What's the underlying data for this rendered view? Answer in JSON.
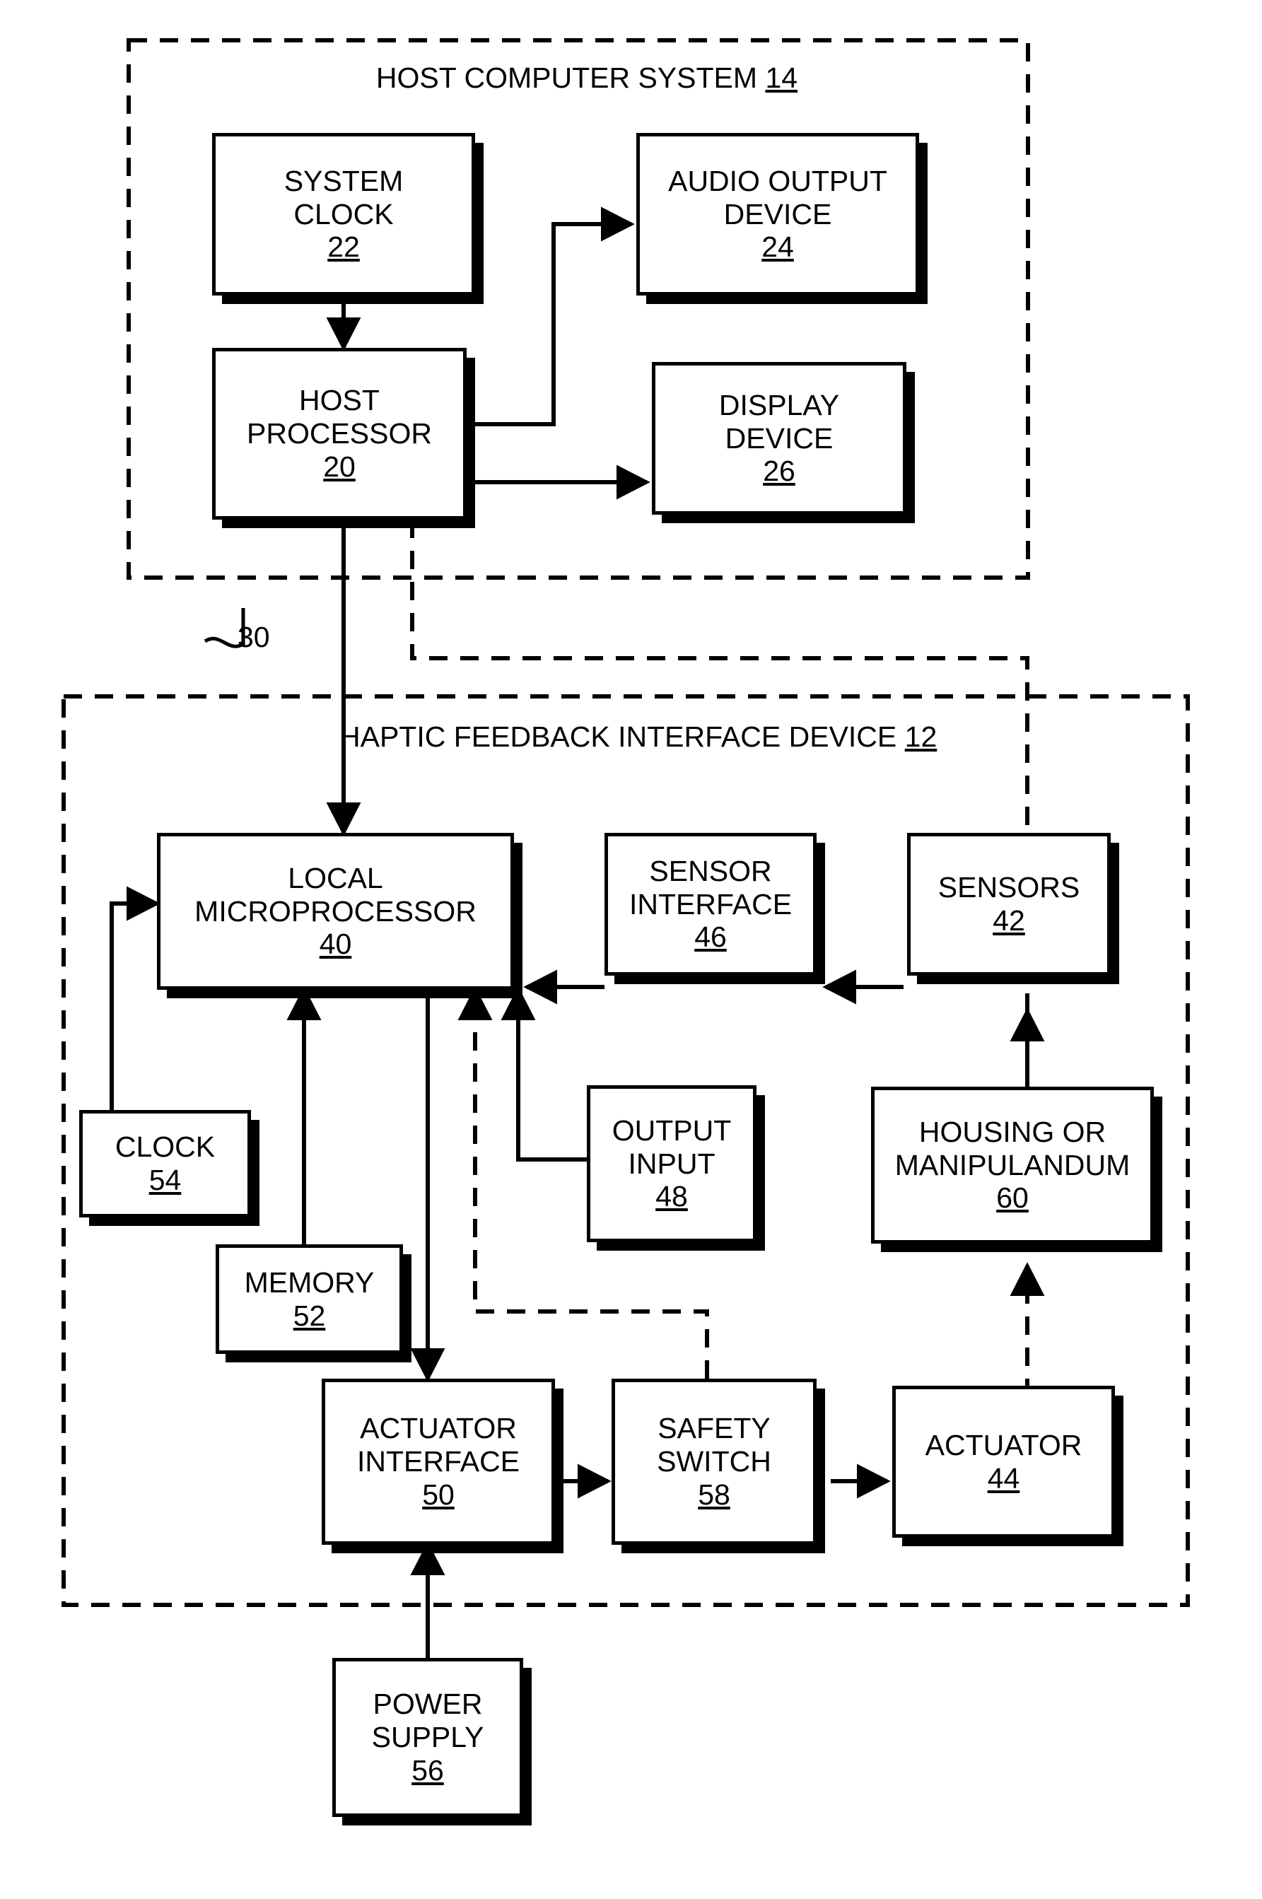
{
  "figure": {
    "type": "patent-block-diagram",
    "groups": [
      {
        "id": "host-computer-system",
        "title_line1": "HOST COMPUTER SYSTEM",
        "title_ref": "14",
        "border": "dashed"
      },
      {
        "id": "haptic-feedback-interface-device",
        "title_line1": "HAPTIC FEEDBACK",
        "title_line2": "INTERFACE DEVICE",
        "title_ref": "12",
        "border": "dashed"
      }
    ],
    "bus_label": "30",
    "blocks": [
      {
        "id": "system-clock",
        "line1": "SYSTEM",
        "line2": "CLOCK",
        "num": "22"
      },
      {
        "id": "audio-output-device",
        "line1": "AUDIO OUTPUT",
        "line2": "DEVICE",
        "num": "24"
      },
      {
        "id": "host-processor",
        "line1": "HOST",
        "line2": "PROCESSOR",
        "num": "20"
      },
      {
        "id": "display-device",
        "line1": "DISPLAY",
        "line2": "DEVICE",
        "num": "26"
      },
      {
        "id": "local-microprocessor",
        "line1": "LOCAL",
        "line2": "MICROPROCESSOR",
        "num": "40"
      },
      {
        "id": "sensor-interface",
        "line1": "SENSOR",
        "line2": "INTERFACE",
        "num": "46"
      },
      {
        "id": "sensors",
        "line1": "SENSORS",
        "line2": "",
        "num": "42"
      },
      {
        "id": "clock",
        "line1": "CLOCK",
        "line2": "",
        "num": "54"
      },
      {
        "id": "output-input",
        "line1": "OUTPUT",
        "line2": "INPUT",
        "num": "48"
      },
      {
        "id": "housing-or-manipulandum",
        "line1": "HOUSING OR",
        "line2": "MANIPULANDUM",
        "num": "60"
      },
      {
        "id": "memory",
        "line1": "MEMORY",
        "line2": "",
        "num": "52"
      },
      {
        "id": "actuator-interface",
        "line1": "ACTUATOR",
        "line2": "INTERFACE",
        "num": "50"
      },
      {
        "id": "safety-switch",
        "line1": "SAFETY",
        "line2": "SWITCH",
        "num": "58"
      },
      {
        "id": "actuator",
        "line1": "ACTUATOR",
        "line2": "",
        "num": "44"
      },
      {
        "id": "power-supply",
        "line1": "POWER",
        "line2": "SUPPLY",
        "num": "56"
      }
    ],
    "colors": {
      "ink": "#000000",
      "paper": "#ffffff"
    }
  }
}
